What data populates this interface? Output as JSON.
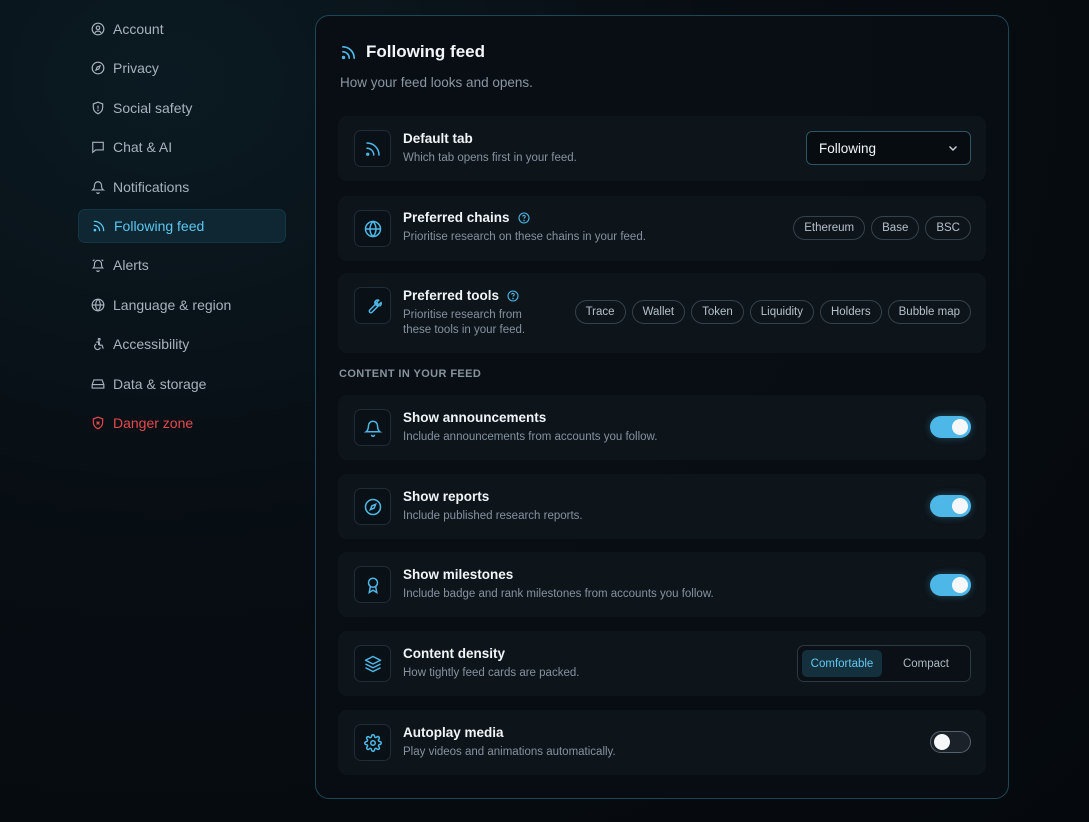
{
  "sidebar": {
    "items": [
      {
        "label": "Account",
        "icon": "user-circle-icon"
      },
      {
        "label": "Privacy",
        "icon": "compass-icon"
      },
      {
        "label": "Social safety",
        "icon": "shield-icon"
      },
      {
        "label": "Chat & AI",
        "icon": "chat-icon"
      },
      {
        "label": "Notifications",
        "icon": "bell-icon"
      },
      {
        "label": "Following feed",
        "icon": "rss-icon",
        "active": true
      },
      {
        "label": "Alerts",
        "icon": "alarm-icon"
      },
      {
        "label": "Language & region",
        "icon": "globe-icon"
      },
      {
        "label": "Accessibility",
        "icon": "accessibility-icon"
      },
      {
        "label": "Data & storage",
        "icon": "storage-icon"
      },
      {
        "label": "Danger zone",
        "icon": "danger-icon",
        "danger": true
      }
    ]
  },
  "panel": {
    "title": "Following feed",
    "subtitle": "How your feed looks and opens.",
    "default_tab": {
      "title": "Default tab",
      "desc": "Which tab opens first in your feed.",
      "value": "Following"
    },
    "chains": {
      "title": "Preferred chains",
      "desc": "Prioritise research on these chains in your feed.",
      "options": [
        "Ethereum",
        "Base",
        "BSC"
      ]
    },
    "tools": {
      "title": "Preferred tools",
      "desc_line1": "Prioritise research from",
      "desc_line2": "these tools in your feed.",
      "options": [
        "Trace",
        "Wallet",
        "Token",
        "Liquidity",
        "Holders",
        "Bubble map"
      ]
    },
    "section_label": "CONTENT IN YOUR FEED",
    "announcements": {
      "title": "Show announcements",
      "desc": "Include announcements from accounts you follow.",
      "enabled": true
    },
    "reports": {
      "title": "Show reports",
      "desc": "Include published research reports.",
      "enabled": true
    },
    "milestones": {
      "title": "Show milestones",
      "desc": "Include badge and rank milestones from accounts you follow.",
      "enabled": true
    },
    "density": {
      "title": "Content density",
      "desc": "How tightly feed cards are packed.",
      "options": [
        "Comfortable",
        "Compact"
      ],
      "selected": "Comfortable"
    },
    "autoplay": {
      "title": "Autoplay media",
      "desc": "Play videos and animations automatically.",
      "enabled": false
    }
  },
  "colors": {
    "accent": "#4db8e8",
    "danger": "#e5484d",
    "panel_border": "#1c4756"
  }
}
